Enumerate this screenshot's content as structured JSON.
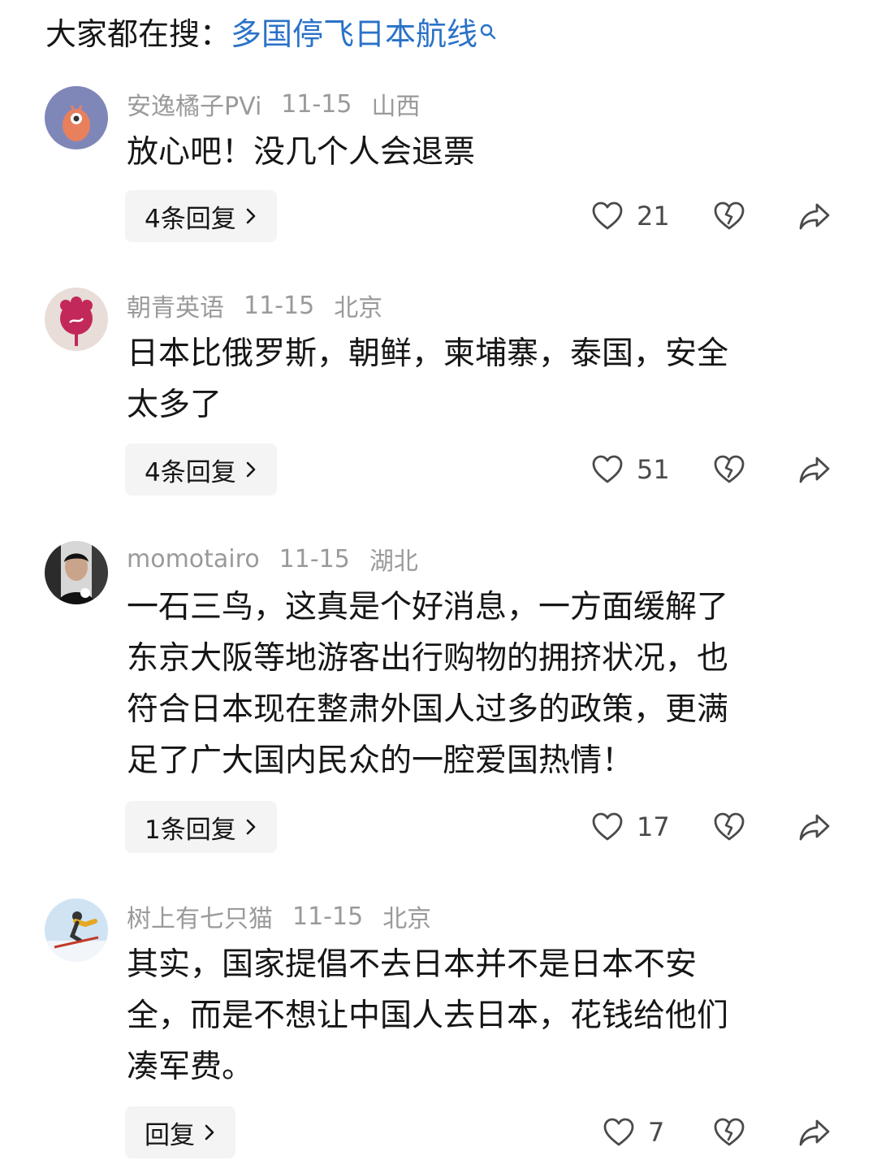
{
  "search": {
    "prefix": "大家都在搜：",
    "term": "多国停飞日本航线"
  },
  "comments": [
    {
      "user": "安逸橘子PVi",
      "date": "11-15",
      "location": "山西",
      "lines": [
        "放心吧！没几个人会退票"
      ],
      "reply_label": "4条回复",
      "likes": "21"
    },
    {
      "user": "朝青英语",
      "date": "11-15",
      "location": "北京",
      "lines": [
        "日本比俄罗斯，朝鲜，柬埔寨，泰国，安全",
        "太多了"
      ],
      "reply_label": "4条回复",
      "likes": "51"
    },
    {
      "user": "momotairo",
      "date": "11-15",
      "location": "湖北",
      "lines": [
        "一石三鸟，这真是个好消息，一方面缓解了",
        "东京大阪等地游客出行购物的拥挤状况，也",
        "符合日本现在整肃外国人过多的政策，更满",
        "足了广大国内民众的一腔爱国热情！"
      ],
      "reply_label": "1条回复",
      "likes": "17"
    },
    {
      "user": "树上有七只猫",
      "date": "11-15",
      "location": "北京",
      "lines": [
        "其实，国家提倡不去日本并不是日本不安",
        "全，而是不想让中国人去日本，花钱给他们",
        "凑军费。"
      ],
      "reply_label": "回复",
      "likes": "7"
    }
  ],
  "colors": {
    "link": "#2a72c8",
    "meta": "#9a9a9a",
    "button_bg": "#f4f4f4"
  },
  "icons": {
    "like": "heart-outline-icon",
    "dislike": "broken-heart-icon",
    "share": "share-arrow-icon",
    "chevron": "chevron-right-icon"
  }
}
